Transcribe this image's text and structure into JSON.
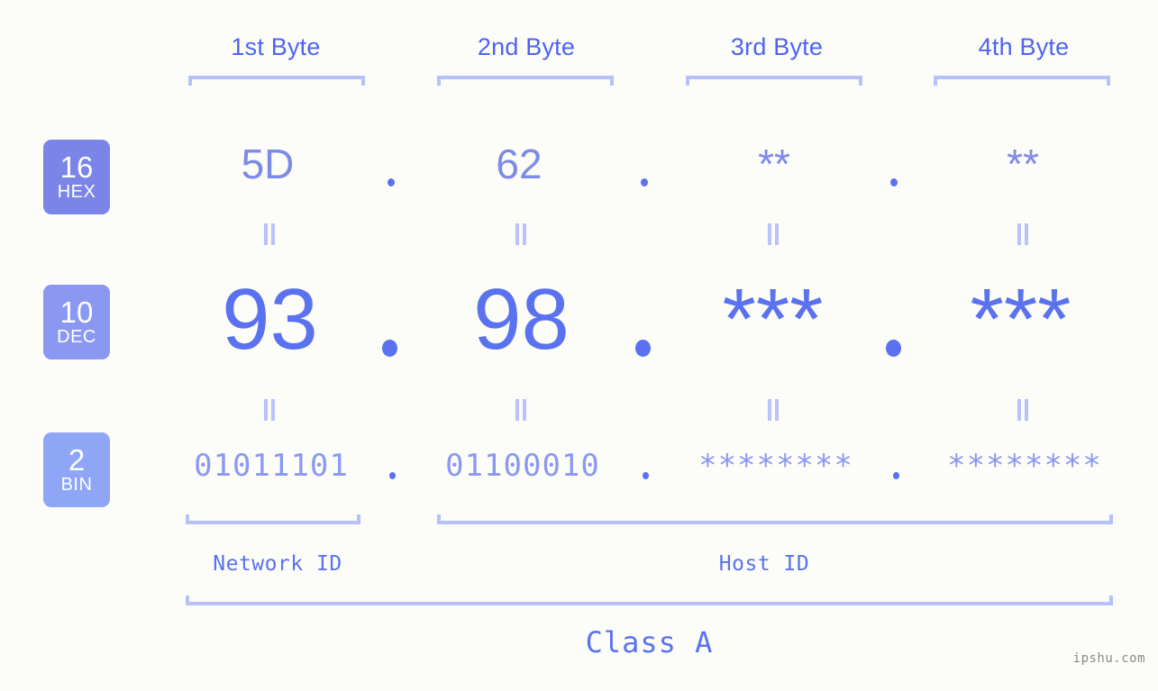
{
  "background_color": "#fcfdf8",
  "accent_colors": {
    "strong_blue": "#4e63ef",
    "dec_blue": "#5a72ef",
    "hex_violet": "#7d8ae8",
    "bin_blue": "#8b98f0",
    "bracket": "#b6c0f9",
    "badge_hex": "#7b85e8",
    "badge_dec": "#8a98f2",
    "badge_bin": "#8fa6f7",
    "watermark": "#8a8a8a"
  },
  "byte_headers": [
    {
      "label": "1st Byte"
    },
    {
      "label": "2nd Byte"
    },
    {
      "label": "3rd Byte"
    },
    {
      "label": "4th Byte"
    }
  ],
  "bases": [
    {
      "number": "16",
      "name": "HEX"
    },
    {
      "number": "10",
      "name": "DEC"
    },
    {
      "number": "2",
      "name": "BIN"
    }
  ],
  "rows": {
    "hex": {
      "base_number": "16",
      "base_name": "HEX",
      "values": [
        "5D",
        "62",
        "**",
        "**"
      ],
      "separator": "."
    },
    "dec": {
      "base_number": "10",
      "base_name": "DEC",
      "values": [
        "93",
        "98",
        "***",
        "***"
      ],
      "separator": "."
    },
    "bin": {
      "base_number": "2",
      "base_name": "BIN",
      "values": [
        "01011101",
        "01100010",
        "********",
        "********"
      ],
      "separator": "."
    }
  },
  "equality_symbol": "=",
  "sections": {
    "network_id": "Network ID",
    "host_id": "Host ID",
    "class": "Class A"
  },
  "watermark": "ipshu.com"
}
